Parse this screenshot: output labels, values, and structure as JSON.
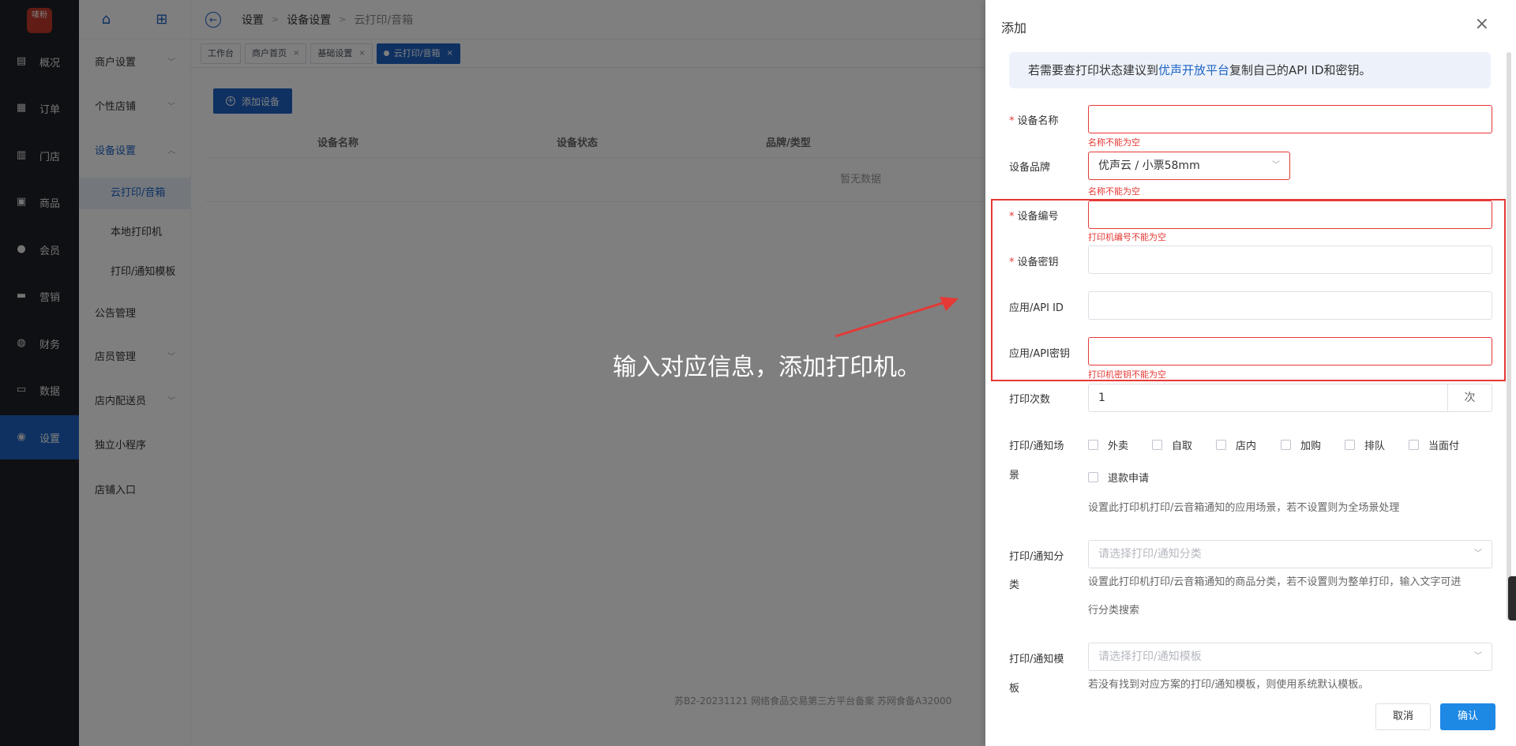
{
  "logo": {
    "text": "唛粉"
  },
  "nav": [
    {
      "label": "概况",
      "icon": "dashboard-icon",
      "glyph": "▤"
    },
    {
      "label": "订单",
      "icon": "order-icon",
      "glyph": "▦"
    },
    {
      "label": "门店",
      "icon": "store-icon",
      "glyph": "▥"
    },
    {
      "label": "商品",
      "icon": "bag-icon",
      "glyph": "▣"
    },
    {
      "label": "会员",
      "icon": "user-icon",
      "glyph": "●"
    },
    {
      "label": "营销",
      "icon": "marketing-icon",
      "glyph": "▬"
    },
    {
      "label": "财务",
      "icon": "money-icon",
      "glyph": "◍"
    },
    {
      "label": "数据",
      "icon": "monitor-icon",
      "glyph": "▭"
    },
    {
      "label": "设置",
      "icon": "settings-icon",
      "glyph": "◉"
    }
  ],
  "sub_menu": [
    {
      "label": "商户设置",
      "chevron": "﹀"
    },
    {
      "label": "个性店铺",
      "chevron": "﹀"
    },
    {
      "label": "设备设置",
      "chevron": "︿"
    },
    {
      "label": "云打印/音箱"
    },
    {
      "label": "本地打印机"
    },
    {
      "label": "打印/通知模板"
    },
    {
      "label": "公告管理"
    },
    {
      "label": "店员管理",
      "chevron": "﹀"
    },
    {
      "label": "店内配送员",
      "chevron": "﹀"
    },
    {
      "label": "独立小程序"
    },
    {
      "label": "店铺入口"
    }
  ],
  "breadcrumb": [
    "设置",
    "设备设置",
    "云打印/音箱"
  ],
  "tags": [
    {
      "label": "工作台"
    },
    {
      "label": "商户首页"
    },
    {
      "label": "基础设置"
    },
    {
      "label": "云打印/音箱"
    }
  ],
  "main": {
    "add_button": "添加设备",
    "columns": [
      "设备名称",
      "设备状态",
      "品牌/类型"
    ],
    "empty_text": "暂无数据",
    "footer": "苏B2-20231121  网络食品交易第三方平台备案 苏网食备A32000"
  },
  "annotation": "输入对应信息，添加打印机。",
  "drawer": {
    "title": "添加",
    "alert_prefix": "若需要查打印状态建议到",
    "alert_link": "优声开放平台",
    "alert_suffix": "复制自己的API ID和密钥。",
    "fields": {
      "device_name": {
        "label": "设备名称",
        "value": "",
        "error": "名称不能为空"
      },
      "device_brand": {
        "label": "设备品牌",
        "value": "优声云 / 小票58mm",
        "error": "名称不能为空"
      },
      "device_no": {
        "label": "设备编号",
        "value": "",
        "error": "打印机编号不能为空"
      },
      "device_key": {
        "label": "设备密钥",
        "value": ""
      },
      "api_id": {
        "label": "应用/API ID",
        "value": ""
      },
      "api_key": {
        "label": "应用/API密钥",
        "value": "",
        "error": "打印机密钥不能为空"
      },
      "print_count": {
        "label": "打印次数",
        "value": "1",
        "suffix": "次"
      },
      "scene": {
        "label_line1": "打印/通知场",
        "label_line2": "景",
        "options": [
          "外卖",
          "自取",
          "店内",
          "加购",
          "排队",
          "当面付",
          "退款申请"
        ],
        "hint": "设置此打印机打印/云音箱通知的应用场景，若不设置则为全场景处理"
      },
      "category": {
        "label_line1": "打印/通知分",
        "label_line2": "类",
        "placeholder": "请选择打印/通知分类",
        "hint_line1": "设置此打印机打印/云音箱通知的商品分类，若不设置则为整单打印，输入文字可进",
        "hint_line2": "行分类搜索"
      },
      "template": {
        "label_line1": "打印/通知模",
        "label_line2": "板",
        "placeholder": "请选择打印/通知模板",
        "hint": "若没有找到对应方案的打印/通知模板，则使用系统默认模板。"
      }
    },
    "cancel": "取消",
    "confirm": "确认"
  },
  "colors": {
    "brand": "#1e63c4",
    "error": "#e53935",
    "nav_bg": "#1f2026",
    "confirm": "#1e88e5"
  }
}
